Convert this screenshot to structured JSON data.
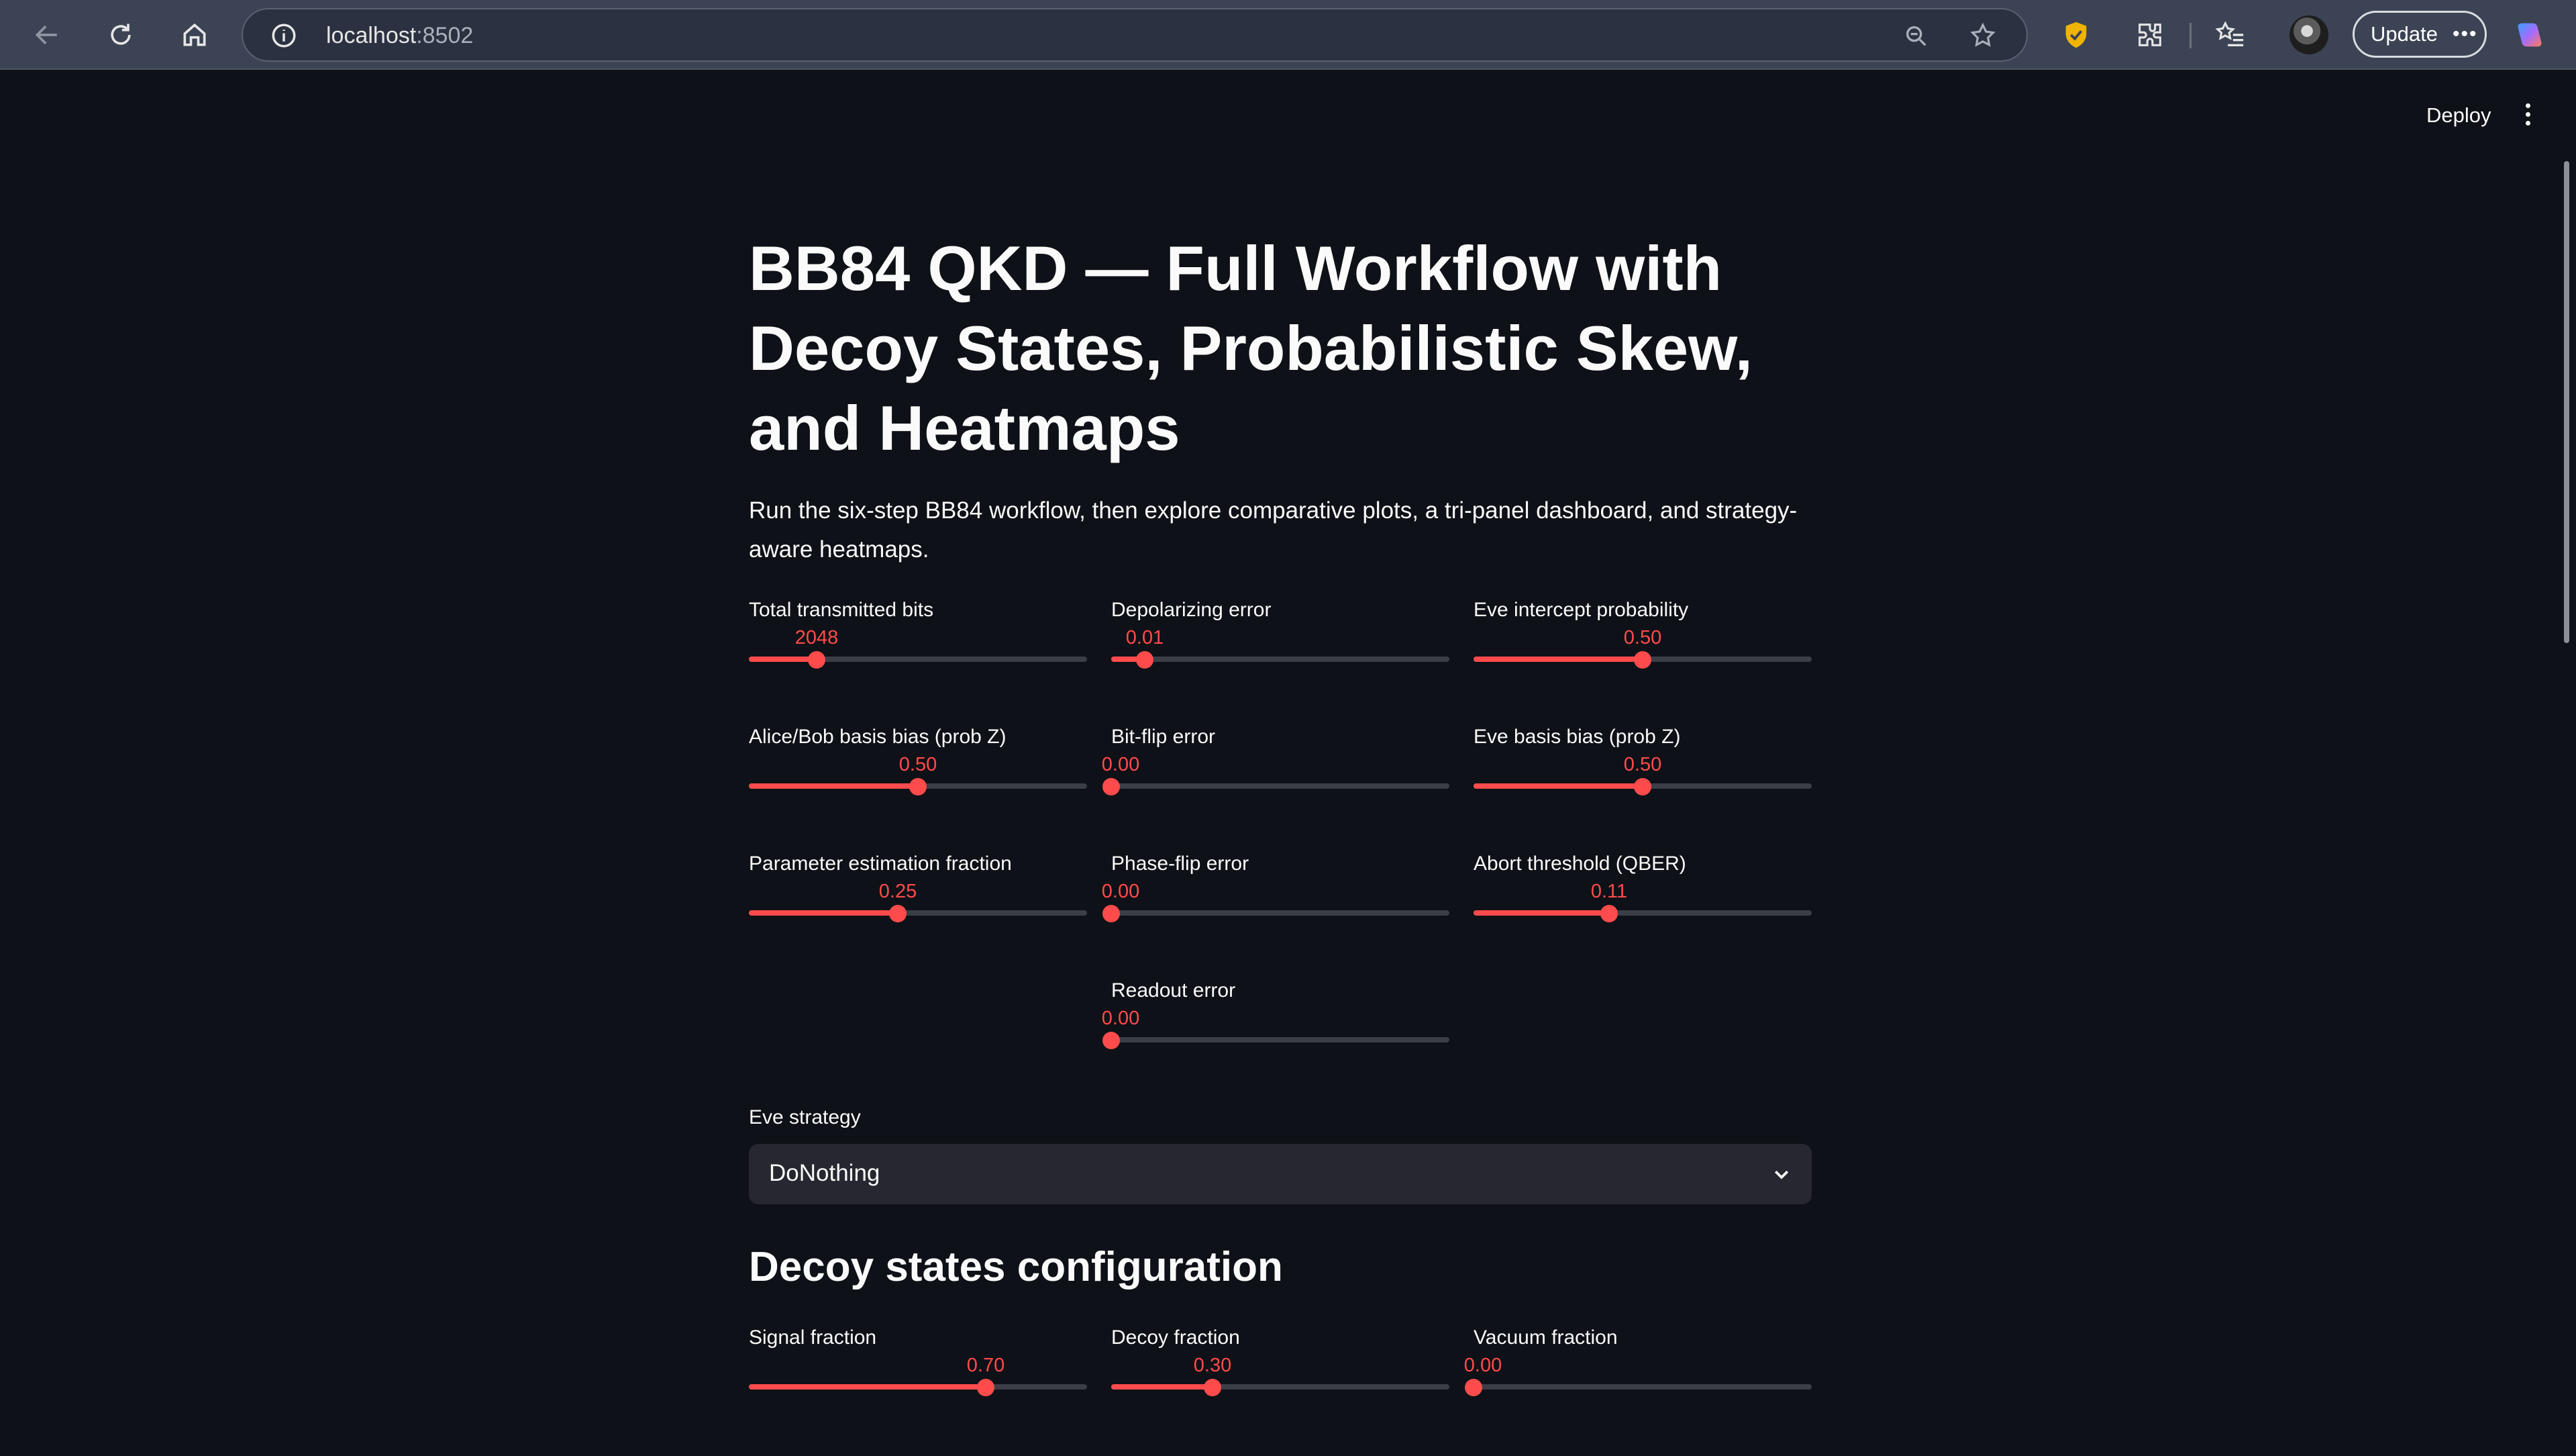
{
  "browser": {
    "url_host": "localhost",
    "url_port": ":8502",
    "update_label": "Update"
  },
  "header": {
    "deploy_label": "Deploy"
  },
  "main": {
    "title": "BB84 QKD — Full Workflow with Decoy States, Probabilistic Skew, and Heatmaps",
    "description": "Run the six-step BB84 workflow, then explore comparative plots, a tri-panel dashboard, and strategy-aware heatmaps."
  },
  "sliders": [
    {
      "label": "Total transmitted bits",
      "value": "2048",
      "fraction": 0.2
    },
    {
      "label": "Depolarizing error",
      "value": "0.01",
      "fraction": 0.1
    },
    {
      "label": "Eve intercept probability",
      "value": "0.50",
      "fraction": 0.5
    },
    {
      "label": "Alice/Bob basis bias (prob Z)",
      "value": "0.50",
      "fraction": 0.5
    },
    {
      "label": "Bit-flip error",
      "value": "0.00",
      "fraction": 0.0
    },
    {
      "label": "Eve basis bias (prob Z)",
      "value": "0.50",
      "fraction": 0.5
    },
    {
      "label": "Parameter estimation fraction",
      "value": "0.25",
      "fraction": 0.44
    },
    {
      "label": "Phase-flip error",
      "value": "0.00",
      "fraction": 0.0
    },
    {
      "label": "Abort threshold (QBER)",
      "value": "0.11",
      "fraction": 0.4
    },
    {
      "label": "Readout error",
      "value": "0.00",
      "fraction": 0.0
    }
  ],
  "eve": {
    "label": "Eve strategy",
    "selected": "DoNothing"
  },
  "decoy": {
    "heading": "Decoy states configuration",
    "sliders": [
      {
        "label": "Signal fraction",
        "value": "0.70",
        "fraction": 0.7
      },
      {
        "label": "Decoy fraction",
        "value": "0.30",
        "fraction": 0.3
      },
      {
        "label": "Vacuum fraction",
        "value": "0.00",
        "fraction": 0.0
      }
    ]
  },
  "colors": {
    "accent": "#ff4b4b",
    "background": "#0e1117",
    "chrome": "#3b4354"
  }
}
